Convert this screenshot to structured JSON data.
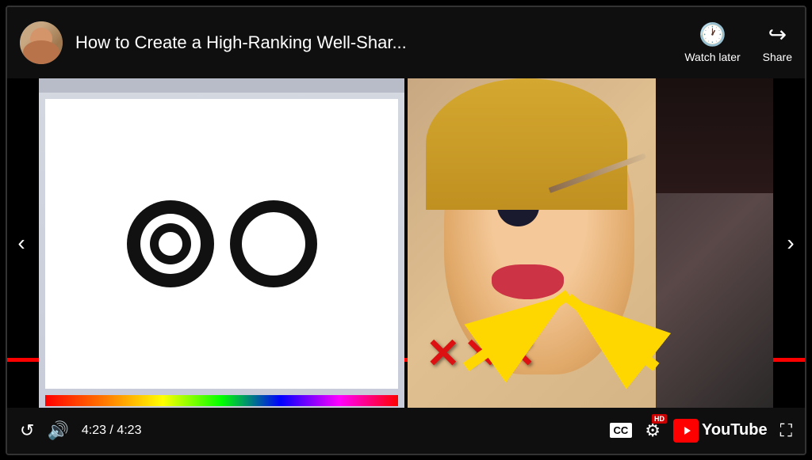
{
  "player": {
    "title": "How to Create a High-Ranking Well-Shar...",
    "watch_later_label": "Watch later",
    "share_label": "Share",
    "time_current": "4:23",
    "time_total": "4:23",
    "time_display": "4:23 / 4:23",
    "prev_arrow": "‹",
    "next_arrow": "›",
    "cc_label": "CC",
    "hd_label": "HD",
    "youtube_label": "YouTube",
    "red_x_1": "✕",
    "red_x_2": "✕",
    "red_x_3": "✕"
  },
  "icons": {
    "watch_later": "🕐",
    "share": "↪",
    "replay": "↺",
    "volume": "🔊",
    "gear": "⚙",
    "fullscreen": "⛶"
  }
}
